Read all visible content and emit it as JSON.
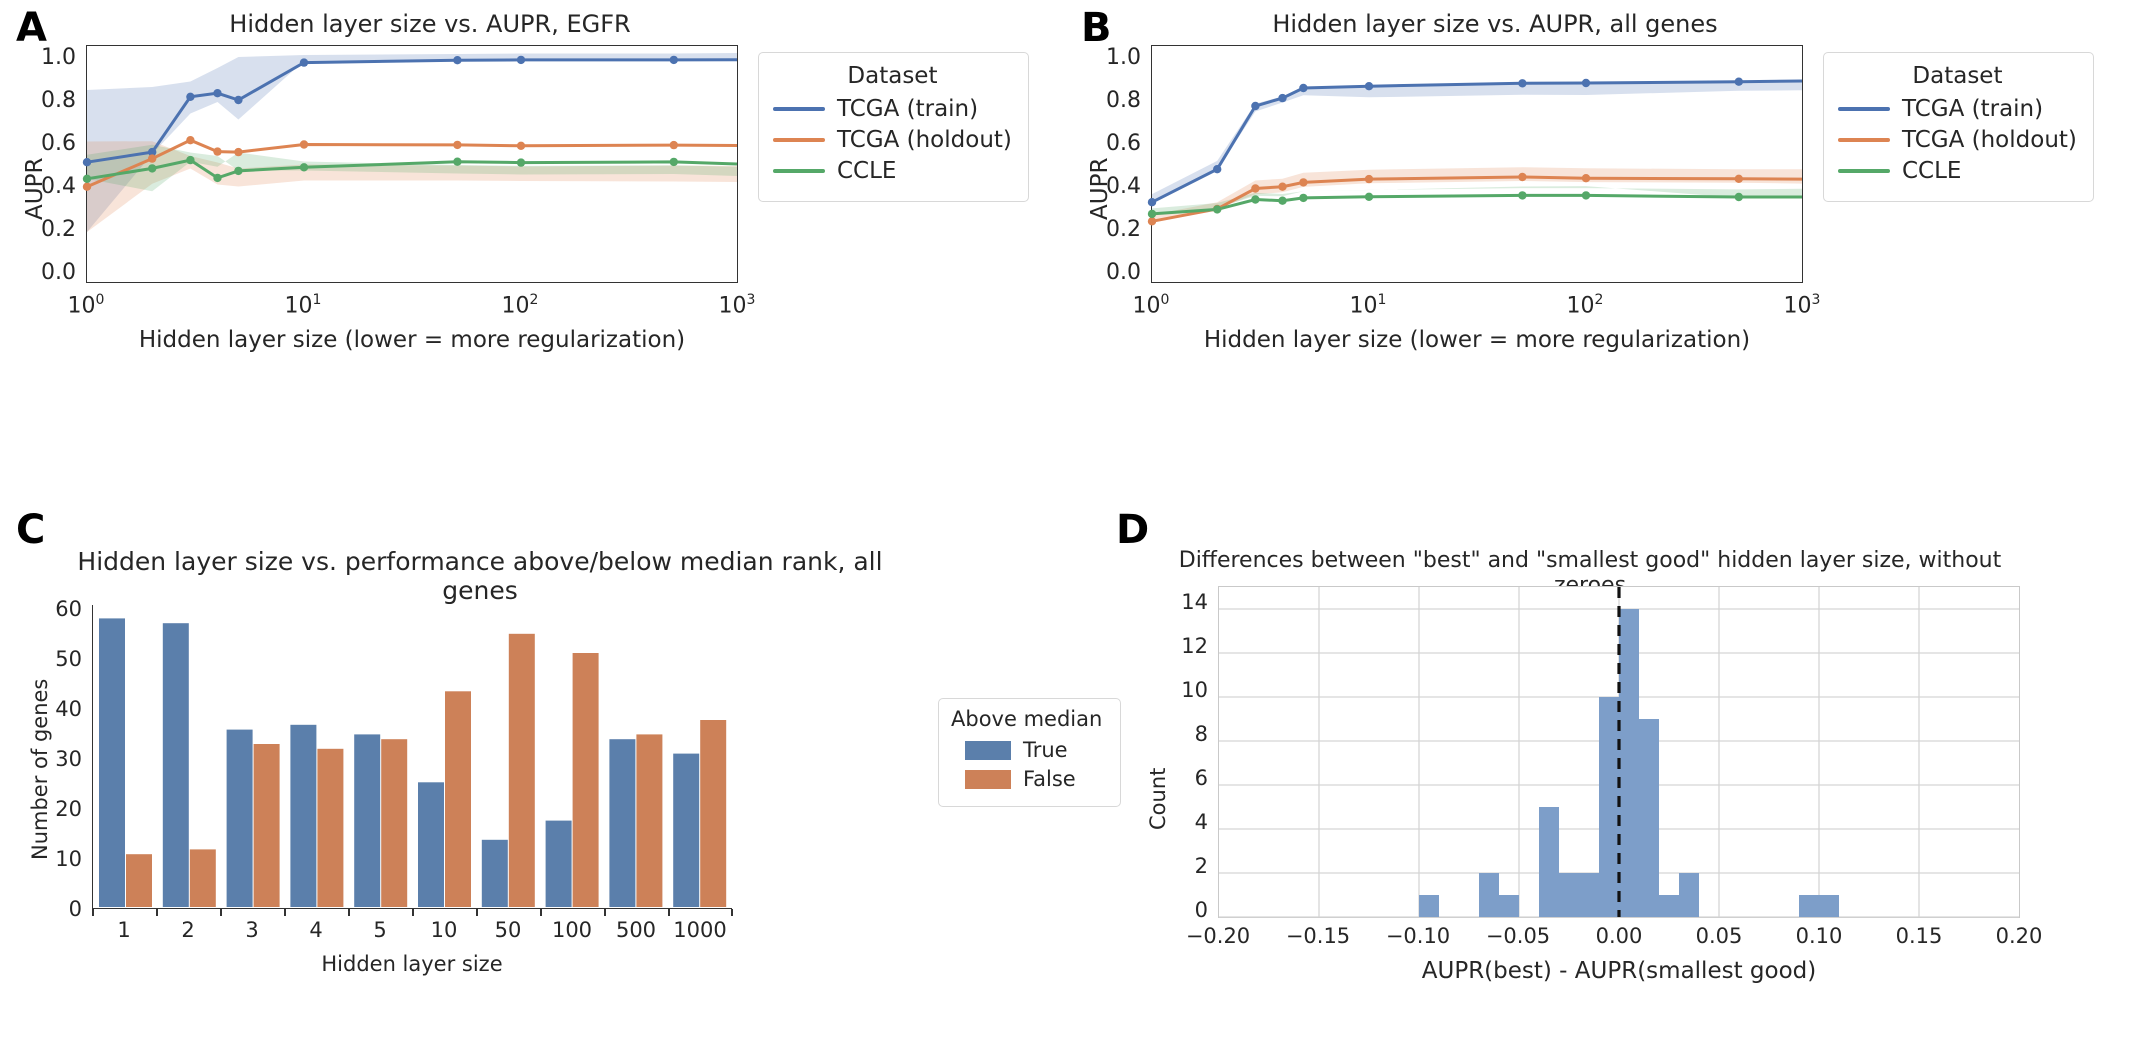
{
  "figure": {
    "panels": [
      "A",
      "B",
      "C",
      "D"
    ],
    "colors": {
      "blue": "#4c72b0",
      "orange": "#dd8452",
      "green": "#55a868",
      "bar_blue": "#5b7fab",
      "bar_orange": "#cd8158",
      "hist_blue": "#7d9ec9",
      "dash": "#111111",
      "grid": "#d5d5d5",
      "axis": "#333333"
    }
  },
  "panelA": {
    "letter": "A",
    "title": "Hidden layer size vs. AUPR, EGFR",
    "ylabel": "AUPR",
    "xlabel": "Hidden layer size (lower = more regularization)",
    "yticks": [
      "0.0",
      "0.2",
      "0.4",
      "0.6",
      "0.8",
      "1.0"
    ],
    "xticks": [
      "10",
      "10",
      "10",
      "10"
    ],
    "xexp": [
      "0",
      "1",
      "2",
      "3"
    ],
    "legend": {
      "title": "Dataset",
      "items": [
        {
          "label": "TCGA (train)",
          "color": "#4c72b0"
        },
        {
          "label": "TCGA (holdout)",
          "color": "#dd8452"
        },
        {
          "label": "CCLE",
          "color": "#55a868"
        }
      ]
    }
  },
  "panelB": {
    "letter": "B",
    "title": "Hidden layer size vs. AUPR, all genes",
    "ylabel": "AUPR",
    "xlabel": "Hidden layer size (lower = more regularization)",
    "yticks": [
      "0.0",
      "0.2",
      "0.4",
      "0.6",
      "0.8",
      "1.0"
    ],
    "xticks": [
      "10",
      "10",
      "10",
      "10"
    ],
    "xexp": [
      "0",
      "1",
      "2",
      "3"
    ],
    "legend": {
      "title": "Dataset",
      "items": [
        {
          "label": "TCGA (train)",
          "color": "#4c72b0"
        },
        {
          "label": "TCGA (holdout)",
          "color": "#dd8452"
        },
        {
          "label": "CCLE",
          "color": "#55a868"
        }
      ]
    }
  },
  "panelC": {
    "letter": "C",
    "title": "Hidden layer size vs. performance above/below median rank, all genes",
    "ylabel": "Number of genes",
    "xlabel": "Hidden layer size",
    "yticks": [
      "0",
      "10",
      "20",
      "30",
      "40",
      "50",
      "60"
    ],
    "legend": {
      "title": "Above median",
      "items": [
        {
          "label": "True",
          "color": "#5b7fab"
        },
        {
          "label": "False",
          "color": "#cd8158"
        }
      ]
    }
  },
  "panelD": {
    "letter": "D",
    "title": "Differences between \"best\" and \"smallest good\" hidden layer size, without zeroes",
    "ylabel": "Count",
    "xlabel": "AUPR(best) - AUPR(smallest good)",
    "yticks": [
      "0",
      "2",
      "4",
      "6",
      "8",
      "10",
      "12",
      "14"
    ],
    "xticks": [
      "−0.20",
      "−0.15",
      "−0.10",
      "−0.05",
      "0.00",
      "0.05",
      "0.10",
      "0.15",
      "0.20"
    ]
  },
  "chart_data": [
    {
      "panel": "A",
      "type": "line",
      "title": "Hidden layer size vs. AUPR, EGFR",
      "xlabel": "Hidden layer size (lower = more regularization)",
      "ylabel": "AUPR",
      "xscale": "log",
      "xlim": [
        1,
        1000
      ],
      "ylim": [
        0.0,
        1.05
      ],
      "x": [
        1,
        2,
        3,
        4,
        5,
        10,
        50,
        100,
        500,
        1000
      ],
      "grid": false,
      "legend_title": "Dataset",
      "legend_position": "right",
      "series": [
        {
          "name": "TCGA (train)",
          "color": "#4c72b0",
          "values": [
            0.533,
            0.578,
            0.779,
            0.84,
            0.81,
            0.976,
            0.987,
            0.988,
            0.988,
            0.989
          ],
          "ci_low": [
            0.215,
            0.32,
            0.7,
            0.74,
            0.655,
            0.962,
            0.98,
            0.981,
            0.981,
            0.983
          ],
          "ci_high": [
            0.85,
            0.818,
            0.842,
            0.91,
            0.96,
            0.99,
            0.993,
            0.994,
            0.994,
            0.994
          ]
        },
        {
          "name": "TCGA (holdout)",
          "color": "#dd8452",
          "values": [
            0.424,
            0.549,
            0.631,
            0.58,
            0.578,
            0.612,
            0.61,
            0.606,
            0.609,
            0.607
          ],
          "ci_low": [
            0.222,
            0.386,
            0.57,
            0.545,
            0.545,
            0.598,
            0.598,
            0.594,
            0.597,
            0.596
          ],
          "ci_high": [
            0.625,
            0.628,
            0.654,
            0.62,
            0.6,
            0.625,
            0.622,
            0.618,
            0.621,
            0.619
          ]
        },
        {
          "name": "CCLE",
          "color": "#55a868",
          "values": [
            0.459,
            0.505,
            0.542,
            0.463,
            0.494,
            0.51,
            0.535,
            0.531,
            0.534,
            0.525
          ],
          "ci_low": [
            0.352,
            0.399,
            0.494,
            0.379,
            0.442,
            0.466,
            0.52,
            0.517,
            0.519,
            0.513
          ],
          "ci_high": [
            0.566,
            0.61,
            0.588,
            0.565,
            0.545,
            0.554,
            0.55,
            0.545,
            0.548,
            0.537
          ]
        }
      ]
    },
    {
      "panel": "B",
      "type": "line",
      "title": "Hidden layer size vs. AUPR, all genes",
      "xlabel": "Hidden layer size (lower = more regularization)",
      "ylabel": "AUPR",
      "xscale": "log",
      "xlim": [
        1,
        1000
      ],
      "ylim": [
        0.0,
        1.05
      ],
      "x": [
        1,
        2,
        3,
        4,
        5,
        10,
        50,
        100,
        500,
        1000
      ],
      "grid": false,
      "legend_title": "Dataset",
      "legend_position": "right",
      "series": [
        {
          "name": "TCGA (train)",
          "color": "#4c72b0",
          "values": [
            0.355,
            0.502,
            0.783,
            0.818,
            0.863,
            0.871,
            0.884,
            0.885,
            0.891,
            0.894
          ],
          "ci_low": [
            0.318,
            0.462,
            0.744,
            0.786,
            0.836,
            0.846,
            0.859,
            0.86,
            0.864,
            0.864
          ],
          "ci_high": [
            0.392,
            0.542,
            0.822,
            0.85,
            0.89,
            0.896,
            0.909,
            0.91,
            0.918,
            0.922
          ]
        },
        {
          "name": "TCGA (holdout)",
          "color": "#dd8452",
          "values": [
            0.222,
            0.277,
            0.368,
            0.376,
            0.395,
            0.41,
            0.419,
            0.414,
            0.411,
            0.41
          ],
          "ci_low": [
            0.195,
            0.248,
            0.338,
            0.348,
            0.368,
            0.383,
            0.392,
            0.387,
            0.383,
            0.38
          ],
          "ci_high": [
            0.249,
            0.306,
            0.398,
            0.404,
            0.422,
            0.437,
            0.446,
            0.441,
            0.439,
            0.44
          ]
        },
        {
          "name": "CCLE",
          "color": "#55a868",
          "values": [
            0.255,
            0.275,
            0.319,
            0.314,
            0.326,
            0.331,
            0.337,
            0.337,
            0.33,
            0.33
          ],
          "ci_low": [
            0.231,
            0.251,
            0.296,
            0.292,
            0.305,
            0.309,
            0.313,
            0.313,
            0.305,
            0.303
          ],
          "ci_high": [
            0.279,
            0.299,
            0.342,
            0.336,
            0.347,
            0.353,
            0.361,
            0.361,
            0.355,
            0.357
          ]
        }
      ]
    },
    {
      "panel": "C",
      "type": "bar",
      "title": "Hidden layer size vs. performance above/below median rank, all genes",
      "xlabel": "Hidden layer size",
      "ylabel": "Number of genes",
      "categories": [
        "1",
        "2",
        "3",
        "4",
        "5",
        "10",
        "50",
        "100",
        "500",
        "1000"
      ],
      "ylim": [
        0,
        63
      ],
      "grid": false,
      "legend_title": "Above median",
      "legend_position": "right",
      "series": [
        {
          "name": "True",
          "color": "#5b7fab",
          "values": [
            60,
            59,
            37,
            38,
            36,
            26,
            14,
            18,
            35,
            32
          ]
        },
        {
          "name": "False",
          "color": "#cd8158",
          "values": [
            11,
            12,
            34,
            33,
            35,
            45,
            57,
            53,
            36,
            39
          ]
        }
      ]
    },
    {
      "panel": "D",
      "type": "bar",
      "title": "Differences between \"best\" and \"smallest good\" hidden layer size, without zeroes",
      "xlabel": "AUPR(best) - AUPR(smallest good)",
      "ylabel": "Count",
      "xlim": [
        -0.2,
        0.2
      ],
      "ylim": [
        0,
        15
      ],
      "grid": true,
      "bin_width": 0.01,
      "bin_centers": [
        -0.095,
        -0.065,
        -0.055,
        -0.035,
        -0.025,
        -0.015,
        -0.005,
        0.005,
        0.015,
        0.025,
        0.035,
        0.095,
        0.105
      ],
      "values": [
        1,
        2,
        1,
        5,
        2,
        2,
        10,
        14,
        9,
        1,
        2,
        1,
        1
      ],
      "annotations": [
        {
          "type": "vline",
          "x": 0.0,
          "style": "dashed",
          "color": "#111111"
        }
      ]
    }
  ]
}
